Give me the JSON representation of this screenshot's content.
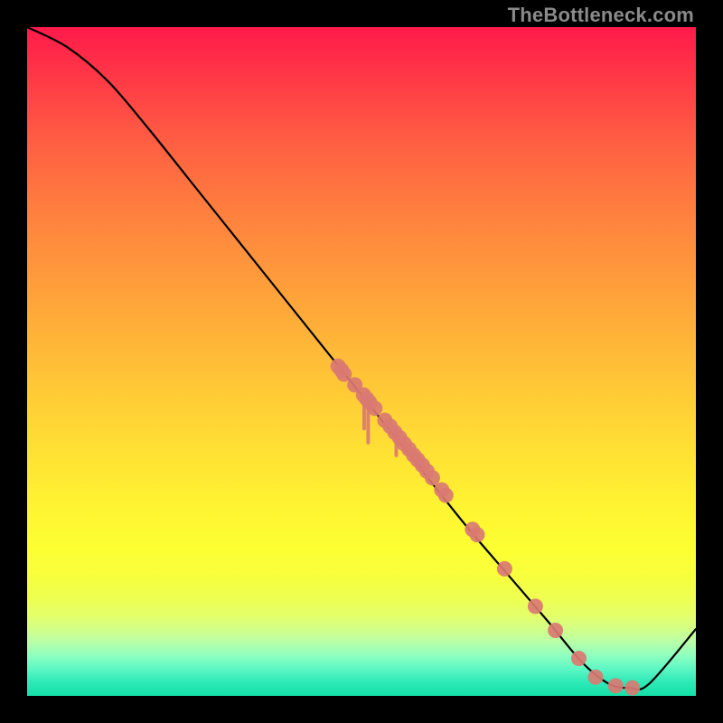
{
  "watermark": "TheBottleneck.com",
  "chart_data": {
    "type": "line",
    "title": "",
    "xlabel": "",
    "ylabel": "",
    "xlim": [
      0,
      100
    ],
    "ylim": [
      0,
      100
    ],
    "grid": false,
    "curve": [
      {
        "x": 0,
        "y": 100
      },
      {
        "x": 6,
        "y": 97
      },
      {
        "x": 12,
        "y": 92
      },
      {
        "x": 18,
        "y": 85
      },
      {
        "x": 24,
        "y": 77.5
      },
      {
        "x": 30,
        "y": 70
      },
      {
        "x": 36,
        "y": 62.5
      },
      {
        "x": 42,
        "y": 55
      },
      {
        "x": 48,
        "y": 47.5
      },
      {
        "x": 54,
        "y": 40
      },
      {
        "x": 60,
        "y": 32.5
      },
      {
        "x": 66,
        "y": 25
      },
      {
        "x": 72,
        "y": 18
      },
      {
        "x": 78,
        "y": 11
      },
      {
        "x": 83,
        "y": 5
      },
      {
        "x": 87,
        "y": 1.8
      },
      {
        "x": 90,
        "y": 1.2
      },
      {
        "x": 93,
        "y": 1.8
      },
      {
        "x": 100,
        "y": 10
      }
    ],
    "series": [
      {
        "name": "cluster-points",
        "color": "#d97a72",
        "points": [
          {
            "x": 46.5,
            "y": 49.3
          },
          {
            "x": 47.0,
            "y": 48.7
          },
          {
            "x": 47.4,
            "y": 48.1
          },
          {
            "x": 49.0,
            "y": 46.5
          },
          {
            "x": 50.3,
            "y": 45.0
          },
          {
            "x": 50.8,
            "y": 44.4
          },
          {
            "x": 51.2,
            "y": 43.9
          },
          {
            "x": 52.0,
            "y": 43.0
          },
          {
            "x": 53.5,
            "y": 41.2
          },
          {
            "x": 54.3,
            "y": 40.3
          },
          {
            "x": 55.0,
            "y": 39.4
          },
          {
            "x": 55.7,
            "y": 38.6
          },
          {
            "x": 56.4,
            "y": 37.7
          },
          {
            "x": 57.1,
            "y": 36.9
          },
          {
            "x": 57.8,
            "y": 36.0
          },
          {
            "x": 58.4,
            "y": 35.3
          },
          {
            "x": 59.1,
            "y": 34.5
          },
          {
            "x": 59.8,
            "y": 33.6
          },
          {
            "x": 60.6,
            "y": 32.6
          },
          {
            "x": 62.0,
            "y": 30.8
          },
          {
            "x": 62.6,
            "y": 30.0
          },
          {
            "x": 66.6,
            "y": 24.9
          },
          {
            "x": 67.3,
            "y": 24.1
          },
          {
            "x": 71.4,
            "y": 19.0
          },
          {
            "x": 76.0,
            "y": 13.4
          },
          {
            "x": 79.0,
            "y": 9.8
          },
          {
            "x": 82.5,
            "y": 5.6
          },
          {
            "x": 85.0,
            "y": 2.8
          },
          {
            "x": 88.0,
            "y": 1.5
          },
          {
            "x": 90.5,
            "y": 1.2
          }
        ]
      }
    ],
    "drips": [
      {
        "x": 50.4,
        "y": 44.6,
        "len": 1.4
      },
      {
        "x": 51.0,
        "y": 43.9,
        "len": 1.8
      },
      {
        "x": 55.2,
        "y": 39.2,
        "len": 1.0
      }
    ]
  }
}
